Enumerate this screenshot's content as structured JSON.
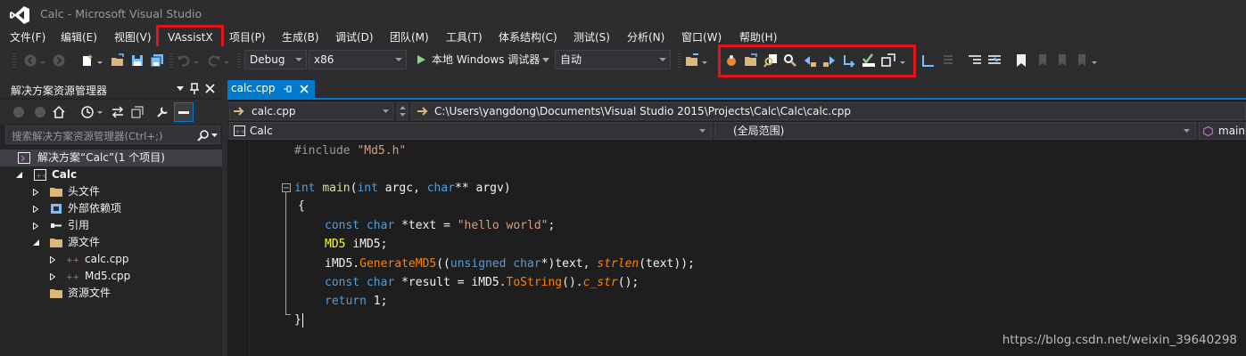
{
  "window": {
    "title": "Calc - Microsoft Visual Studio"
  },
  "menu": {
    "items": [
      "文件(F)",
      "编辑(E)",
      "视图(V)",
      "VAssistX",
      "项目(P)",
      "生成(B)",
      "调试(D)",
      "团队(M)",
      "工具(T)",
      "体系结构(C)",
      "测试(S)",
      "分析(N)",
      "窗口(W)",
      "帮助(H)"
    ],
    "highlighted": "VAssistX",
    "highlight_color": "#e3141c"
  },
  "toolbar": {
    "config": "Debug",
    "platform": "x86",
    "run_label": "本地 Windows 调试器",
    "mode": "自动"
  },
  "solution_explorer": {
    "title": "解决方案资源管理器",
    "search_placeholder": "搜索解决方案资源管理器(Ctrl+;)",
    "items": [
      {
        "label": "解决方案“Calc”(1 个项目)"
      },
      {
        "label": "Calc"
      },
      {
        "label": "头文件"
      },
      {
        "label": "外部依赖项"
      },
      {
        "label": "引用"
      },
      {
        "label": "源文件"
      },
      {
        "label": "calc.cpp"
      },
      {
        "label": "Md5.cpp"
      },
      {
        "label": "资源文件"
      }
    ]
  },
  "editor": {
    "tab_label": "calc.cpp",
    "nav_file": "calc.cpp",
    "nav_path": "C:\\Users\\yangdong\\Documents\\Visual Studio 2015\\Projects\\Calc\\Calc\\calc.cpp",
    "scope_project": "Calc",
    "scope_global": "(全局范围)",
    "scope_member": "main",
    "code": {
      "l1_a": "#include ",
      "l1_b": "\"Md5.h\"",
      "l3_kw": "int",
      "l3_fn": "main",
      "l3_kw2": "int",
      "l3_p1": "argc, ",
      "l3_kw3": "char",
      "l3_p2": "** argv)",
      "l4": "{",
      "l5_kw": "const char",
      "l5_id": " *text = ",
      "l5_str": "\"hello world\"",
      "l5_end": ";",
      "l6_tp": "MD5",
      "l6_id": "iMD5",
      "l6_end": ";",
      "l7_a": "iMD5.",
      "l7_fn": "GenerateMD5",
      "l7_b": "((",
      "l7_kw": "unsigned char",
      "l7_c": "*)text, ",
      "l7_fn2": "strlen",
      "l7_d": "(text));",
      "l8_kw": "const char",
      "l8_a": " *result = iMD5.",
      "l8_fn": "ToString",
      "l8_b": "().",
      "l8_fn2": "c_str",
      "l8_c": "();",
      "l9_kw": "return",
      "l9_a": " 1;",
      "l10": "}"
    }
  },
  "watermark": "https://blog.csdn.net/weixin_39640298"
}
